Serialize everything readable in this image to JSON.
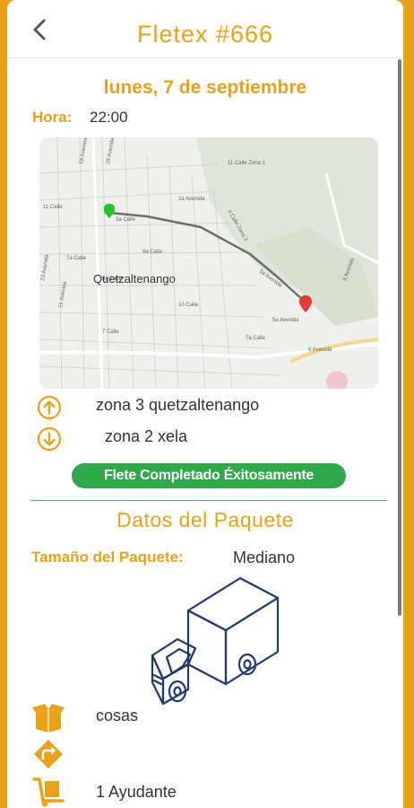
{
  "header": {
    "title": "Fletex #666",
    "back_icon": "chevron-left-icon"
  },
  "schedule": {
    "date": "lunes, 7 de septiembre",
    "time_label": "Hora:",
    "time_value": "22:00"
  },
  "map": {
    "city_label": "Quetzaltenango",
    "street_labels": [
      "11 Calle Zona 1",
      "11 Calle",
      "29 Avenida",
      "2a Avenida",
      "3a Calle",
      "4 Calle Zona 3",
      "7a Calle",
      "8a Calle",
      "9a Calle",
      "10 Calle",
      "19 Avenida",
      "21 Avenida",
      "23 Avenida",
      "7 Calle",
      "7a Calle",
      "5a Avenida",
      "6 Avenida",
      "8 Avenida",
      "5a Avenida"
    ],
    "origin_marker_color": "#22c42a",
    "destination_marker_color": "#e53935",
    "route_color": "#6e6e6e"
  },
  "route": {
    "origin": "zona 3 quetzaltenango",
    "destination": "zona 2 xela",
    "origin_icon": "arrow-up-circle-icon",
    "destination_icon": "arrow-down-circle-icon"
  },
  "status": {
    "label": "Flete Completado Éxitosamente",
    "color": "#2ea84a"
  },
  "package": {
    "section_title": "Datos del Paquete",
    "size_label": "Tamaño del Paquete:",
    "size_value": "Mediano",
    "truck_icon": "truck-icon",
    "items": [
      {
        "icon": "box-icon",
        "text": "cosas"
      },
      {
        "icon": "turn-right-sign-icon",
        "text": ""
      },
      {
        "icon": "dolly-icon",
        "text": "1 Ayudante"
      }
    ]
  },
  "colors": {
    "accent": "#e9a21a",
    "frame": "#e8a01a",
    "truck_stroke": "#1e3a6e"
  }
}
